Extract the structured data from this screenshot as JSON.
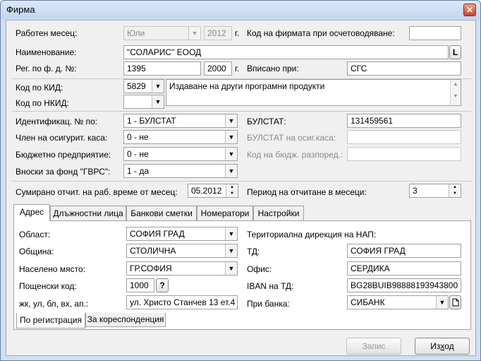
{
  "window": {
    "title": "Фирма",
    "close": "✕"
  },
  "top": {
    "work_month_label": "Работен месец:",
    "work_month_value": "Юли",
    "work_year_value": "2012",
    "year_suffix": "г.",
    "insurance_code_label": "Код на фирмата при осчетоводяване:",
    "insurance_code_value": "",
    "name_label": "Наименование:",
    "name_value": "\"СОЛАРИС\" ЕООД",
    "name_btn": "L",
    "reg_label": "Рег. по ф. д. №:",
    "reg_value": "1395",
    "reg_year_value": "2000",
    "reg_year_suffix": "г.",
    "entered_label": "Вписано при:",
    "entered_value": "СГС",
    "kid_label": "Код по КИД:",
    "kid_value": "5829",
    "nkid_label": "Код по НКИД:",
    "nkid_value": "",
    "activity_text": "Издаване на други програмни продукти",
    "id_label": "Идентификац. № по:",
    "id_value": "1 - БУЛСТАТ",
    "bulstat_label": "БУЛСТАТ:",
    "bulstat_value": "131459561",
    "fund_label": "Член на осигурит. каса:",
    "fund_value": "0 - не",
    "fund_bulstat_label": "БУЛСТАТ на осиг.каса:",
    "fund_bulstat_value": "",
    "budget_label": "Бюджетно предприятие:",
    "budget_value": "0 - не",
    "budget_code_label": "Код на бюдж. разпоред.:",
    "budget_code_value": "",
    "gvrs_label": "Вноски за фонд \"ГВРС\":",
    "gvrs_value": "1 - да",
    "summed_label": "Сумирано отчит. на раб. време от месец:",
    "summed_value": "05.2012",
    "period_label": "Период на отчитане в месеци:",
    "period_value": "3"
  },
  "tabs": [
    "Адрес",
    "Длъжностни лица",
    "Банкови сметки",
    "Номератори",
    "Настройки"
  ],
  "address": {
    "region_label": "Област:",
    "region_value": "СОФИЯ ГРАД",
    "municipality_label": "Община:",
    "municipality_value": "СТОЛИЧНА",
    "place_label": "Населено място:",
    "place_value": "ГР.СОФИЯ",
    "postcode_label": "Пощенски код:",
    "postcode_value": "1000",
    "postcode_help": "?",
    "street_label": "жк, ул, бл, вх, ап.:",
    "street_value": "ул. Христо Станчев 13 ет.4 ап.",
    "nap_label": "Териториална дирекция на НАП:",
    "td_label": "ТД:",
    "td_value": "СОФИЯ ГРАД",
    "office_label": "Офис:",
    "office_value": "СЕРДИКА",
    "iban_label": "IBAN на ТД:",
    "iban_value": "BG28BUIB98888193943800",
    "bank_label": "При банка:",
    "bank_value": "СИБАНК"
  },
  "subtabs": [
    "По регистрация",
    "За кореспонденция"
  ],
  "footer": {
    "save": "Запис",
    "exit_pre": "Из",
    "exit_u": "х",
    "exit_post": "од"
  }
}
